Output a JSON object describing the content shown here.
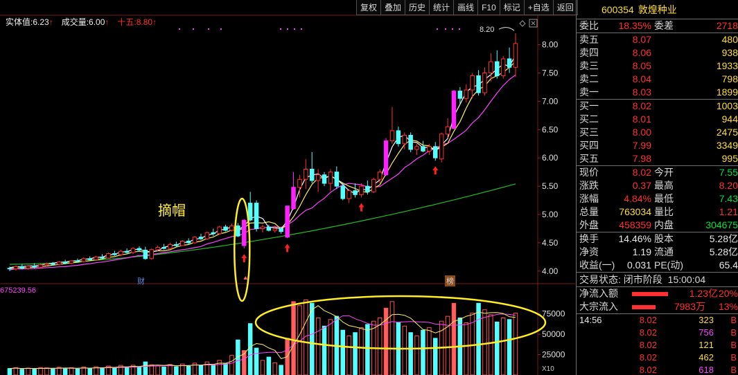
{
  "toolbar": {
    "buttons": [
      "复权",
      "叠加",
      "历史",
      "统计",
      "画线",
      "F10",
      "标记",
      "+自选",
      "返回"
    ]
  },
  "indicators": {
    "entity_label": "实体值:",
    "entity_value": "6.23",
    "entity_arrow": "↑",
    "vol_label": "成交量:",
    "vol_value": "6.00",
    "vol_arrow": "↑",
    "fifteen_label": "十五:",
    "fifteen_value": "8.80",
    "fifteen_arrow": "↑"
  },
  "annotations": {
    "cap_off": "摘帽",
    "vol_readout": "675239.56",
    "x10": "X10",
    "tag_cai": "财",
    "tag_bang": "榜",
    "peak_label": "8.20"
  },
  "price_axis": [
    "8.00",
    "7.50",
    "7.00",
    "6.50",
    "6.00",
    "5.50",
    "5.00",
    "4.50",
    "4.00"
  ],
  "volume_axis": [
    "75000",
    "50000",
    "25000"
  ],
  "stock": {
    "code": "600354",
    "name": "敦煌种业"
  },
  "order_book": {
    "weibi": {
      "label": "委比",
      "value": "18.35%",
      "label2": "委差",
      "value2": "2718"
    },
    "asks": [
      {
        "label": "卖五",
        "price": "8.07",
        "vol": "480"
      },
      {
        "label": "卖四",
        "price": "8.06",
        "vol": "938"
      },
      {
        "label": "卖三",
        "price": "8.05",
        "vol": "1933"
      },
      {
        "label": "卖二",
        "price": "8.04",
        "vol": "798"
      },
      {
        "label": "卖一",
        "price": "8.03",
        "vol": "1899"
      }
    ],
    "bids": [
      {
        "label": "买一",
        "price": "8.02",
        "vol": "1003"
      },
      {
        "label": "买二",
        "price": "8.01",
        "vol": "944"
      },
      {
        "label": "买三",
        "price": "8.00",
        "vol": "2475"
      },
      {
        "label": "买四",
        "price": "7.99",
        "vol": "3349"
      },
      {
        "label": "买五",
        "price": "7.98",
        "vol": "995"
      }
    ]
  },
  "quote": {
    "rows1": [
      {
        "l1": "现价",
        "v1": "8.02",
        "c1": "red",
        "l2": "今开",
        "v2": "7.55",
        "c2": "green"
      },
      {
        "l1": "涨跌",
        "v1": "0.37",
        "c1": "red",
        "l2": "最高",
        "v2": "8.20",
        "c2": "red"
      },
      {
        "l1": "涨幅",
        "v1": "4.84%",
        "c1": "red",
        "l2": "最低",
        "v2": "7.43",
        "c2": "green"
      },
      {
        "l1": "总量",
        "v1": "763034",
        "c1": "yellow",
        "l2": "量比",
        "v2": "1.21",
        "c2": "red"
      },
      {
        "l1": "外盘",
        "v1": "458359",
        "c1": "red",
        "l2": "内盘",
        "v2": "304675",
        "c2": "green"
      }
    ],
    "rows2": [
      {
        "l1": "换手",
        "v1": "14.46%",
        "c1": "white",
        "l2": "股本",
        "v2": "5.28亿",
        "c2": "white"
      },
      {
        "l1": "净资",
        "v1": "1.19",
        "c1": "white",
        "l2": "流通",
        "v2": "5.28亿",
        "c2": "white"
      },
      {
        "l1": "收益(一)",
        "v1": "0.031",
        "c1": "white",
        "l2": "PE(动)",
        "v2": "65.4",
        "c2": "white"
      }
    ]
  },
  "status": {
    "label": "交易状态:",
    "value": "闭市阶段",
    "time": "15:00:04"
  },
  "flows": [
    {
      "label": "净流入额",
      "value": "1.23亿",
      "pct": "20%",
      "bar": 1.0
    },
    {
      "label": "大宗流入",
      "value": "7983万",
      "pct": "13%",
      "bar": 0.65
    }
  ],
  "ticks": [
    {
      "time": "14:56",
      "price": "8.02",
      "vol": "323",
      "dir": "B",
      "vol_color": "yellow",
      "dir_color": "red"
    },
    {
      "time": "",
      "price": "8.02",
      "vol": "756",
      "dir": "B",
      "vol_color": "magenta",
      "dir_color": "red"
    },
    {
      "time": "",
      "price": "8.02",
      "vol": "121",
      "dir": "B",
      "vol_color": "yellow",
      "dir_color": "red"
    },
    {
      "time": "",
      "price": "8.02",
      "vol": "462",
      "dir": "B",
      "vol_color": "yellow",
      "dir_color": "red"
    },
    {
      "time": "",
      "price": "8.02",
      "vol": "618",
      "dir": "B",
      "vol_color": "magenta",
      "dir_color": "red"
    }
  ],
  "chart_data": {
    "type": "candlestick",
    "price_range": [
      3.9,
      8.3
    ],
    "volume_range": [
      0,
      95000
    ],
    "candles": [
      [
        4.05,
        4.08,
        4.0,
        4.04,
        "u",
        8000
      ],
      [
        4.04,
        4.1,
        4.01,
        4.08,
        "u",
        9000
      ],
      [
        4.08,
        4.12,
        4.03,
        4.05,
        "d",
        7000
      ],
      [
        4.05,
        4.1,
        4.02,
        4.09,
        "u",
        8500
      ],
      [
        4.09,
        4.14,
        4.05,
        4.07,
        "d",
        7200
      ],
      [
        4.07,
        4.13,
        4.05,
        4.11,
        "u",
        9100
      ],
      [
        4.11,
        4.15,
        4.08,
        4.13,
        "u",
        8800
      ],
      [
        4.13,
        4.16,
        4.1,
        4.12,
        "d",
        7600
      ],
      [
        4.12,
        4.18,
        4.1,
        4.16,
        "u",
        9400
      ],
      [
        4.16,
        4.2,
        4.12,
        4.14,
        "d",
        7800
      ],
      [
        4.14,
        4.19,
        4.12,
        4.18,
        "u",
        9000
      ],
      [
        4.18,
        4.22,
        4.15,
        4.17,
        "d",
        7400
      ],
      [
        4.17,
        4.24,
        4.15,
        4.22,
        "u",
        9800
      ],
      [
        4.22,
        4.26,
        4.18,
        4.2,
        "d",
        8100
      ],
      [
        4.2,
        4.27,
        4.18,
        4.25,
        "u",
        10200
      ],
      [
        4.25,
        4.3,
        4.21,
        4.23,
        "d",
        8400
      ],
      [
        4.23,
        4.33,
        4.22,
        4.31,
        "u",
        11000
      ],
      [
        4.31,
        4.36,
        4.27,
        4.29,
        "d",
        9000
      ],
      [
        4.29,
        4.38,
        4.26,
        4.35,
        "u",
        11800
      ],
      [
        4.35,
        4.4,
        4.3,
        4.33,
        "d",
        9300
      ],
      [
        4.33,
        4.42,
        4.3,
        4.4,
        "u",
        12000
      ],
      [
        4.4,
        4.44,
        4.34,
        4.37,
        "d",
        9500
      ],
      [
        4.37,
        4.43,
        4.2,
        4.22,
        "d",
        16000
      ],
      [
        4.22,
        4.4,
        4.2,
        4.38,
        "u",
        12500
      ],
      [
        4.38,
        4.45,
        4.35,
        4.42,
        "u",
        11000
      ],
      [
        4.42,
        4.48,
        4.38,
        4.4,
        "d",
        9800
      ],
      [
        4.4,
        4.5,
        4.38,
        4.47,
        "u",
        12800
      ],
      [
        4.47,
        4.52,
        4.43,
        4.45,
        "d",
        10200
      ],
      [
        4.45,
        4.55,
        4.44,
        4.53,
        "u",
        13500
      ],
      [
        4.53,
        4.58,
        4.48,
        4.5,
        "d",
        10800
      ],
      [
        4.5,
        4.62,
        4.48,
        4.6,
        "u",
        14500
      ],
      [
        4.6,
        4.66,
        4.55,
        4.57,
        "d",
        11500
      ],
      [
        4.57,
        4.7,
        4.55,
        4.68,
        "u",
        16000
      ],
      [
        4.68,
        4.75,
        4.62,
        4.66,
        "d",
        12500
      ],
      [
        4.66,
        4.8,
        4.64,
        4.78,
        "u",
        18000
      ],
      [
        4.78,
        4.82,
        4.7,
        4.72,
        "d",
        14000
      ],
      [
        4.72,
        4.84,
        4.7,
        4.8,
        "u",
        24000
      ],
      [
        4.8,
        4.85,
        4.6,
        4.62,
        "d",
        43000
      ],
      [
        4.45,
        4.92,
        4.4,
        4.9,
        "L",
        30000
      ],
      [
        4.9,
        5.4,
        4.88,
        5.2,
        "d",
        63000
      ],
      [
        5.2,
        5.25,
        4.7,
        4.75,
        "u",
        33000
      ],
      [
        4.75,
        4.82,
        4.68,
        4.78,
        "u",
        18000
      ],
      [
        4.78,
        4.82,
        4.7,
        4.72,
        "d",
        22000
      ],
      [
        4.72,
        4.8,
        4.68,
        4.75,
        "u",
        15000
      ],
      [
        4.75,
        4.78,
        4.66,
        4.7,
        "d",
        12000
      ],
      [
        4.6,
        5.15,
        4.58,
        5.15,
        "L",
        45000
      ],
      [
        5.1,
        5.75,
        5.08,
        5.48,
        "L",
        90000
      ],
      [
        5.48,
        5.7,
        5.3,
        5.62,
        "u",
        85000
      ],
      [
        5.62,
        5.98,
        5.45,
        5.8,
        "u",
        92000
      ],
      [
        5.8,
        6.1,
        5.55,
        5.6,
        "u",
        88000
      ],
      [
        5.6,
        5.8,
        5.4,
        5.7,
        "u",
        70000
      ],
      [
        5.7,
        5.75,
        5.5,
        5.55,
        "d",
        60000
      ],
      [
        5.55,
        5.8,
        5.42,
        5.75,
        "u",
        68000
      ],
      [
        5.75,
        5.85,
        5.45,
        5.5,
        "u",
        72000
      ],
      [
        5.5,
        5.55,
        5.25,
        5.28,
        "d",
        55000
      ],
      [
        5.28,
        5.45,
        5.2,
        5.42,
        "u",
        48000
      ],
      [
        5.42,
        5.55,
        5.3,
        5.35,
        "u",
        52000
      ],
      [
        5.35,
        5.55,
        5.3,
        5.5,
        "u",
        58000
      ],
      [
        5.5,
        5.6,
        5.35,
        5.4,
        "u",
        62000
      ],
      [
        5.4,
        5.65,
        5.38,
        5.62,
        "u",
        66000
      ],
      [
        5.62,
        5.8,
        5.55,
        5.75,
        "u",
        70000
      ],
      [
        5.7,
        6.35,
        5.68,
        6.3,
        "L",
        82000
      ],
      [
        6.3,
        6.9,
        6.25,
        6.48,
        "u",
        90000
      ],
      [
        6.48,
        6.55,
        6.2,
        6.25,
        "d",
        64000
      ],
      [
        6.25,
        6.45,
        6.15,
        6.4,
        "u",
        60000
      ],
      [
        6.4,
        6.45,
        6.1,
        6.15,
        "d",
        52000
      ],
      [
        6.15,
        6.25,
        6.05,
        6.2,
        "u",
        48000
      ],
      [
        6.2,
        6.3,
        6.1,
        6.12,
        "u",
        55000
      ],
      [
        6.12,
        6.25,
        6.05,
        6.2,
        "u",
        58000
      ],
      [
        6.2,
        6.28,
        5.95,
        6.0,
        "d",
        45000
      ],
      [
        5.98,
        6.45,
        5.92,
        6.42,
        "u",
        66000
      ],
      [
        6.42,
        6.7,
        6.35,
        6.55,
        "u",
        72000
      ],
      [
        6.52,
        7.2,
        6.5,
        7.18,
        "L",
        88000
      ],
      [
        7.18,
        7.25,
        6.95,
        7.05,
        "u",
        70000
      ],
      [
        7.05,
        7.3,
        6.98,
        7.2,
        "u",
        64000
      ],
      [
        7.2,
        7.5,
        7.05,
        7.45,
        "u",
        76000
      ],
      [
        7.45,
        7.55,
        7.1,
        7.15,
        "d",
        88000
      ],
      [
        7.15,
        7.6,
        7.1,
        7.5,
        "u",
        80000
      ],
      [
        7.5,
        7.85,
        7.35,
        7.7,
        "u",
        74000
      ],
      [
        7.7,
        7.9,
        7.4,
        7.45,
        "u",
        65000
      ],
      [
        7.45,
        7.8,
        7.4,
        7.75,
        "u",
        70000
      ],
      [
        7.75,
        7.95,
        7.5,
        7.6,
        "u",
        68000
      ],
      [
        7.6,
        8.2,
        7.43,
        8.02,
        "u",
        76000
      ]
    ],
    "markers_up_arrow_index": [
      38,
      45,
      57,
      69
    ],
    "annotation_index": 38
  }
}
